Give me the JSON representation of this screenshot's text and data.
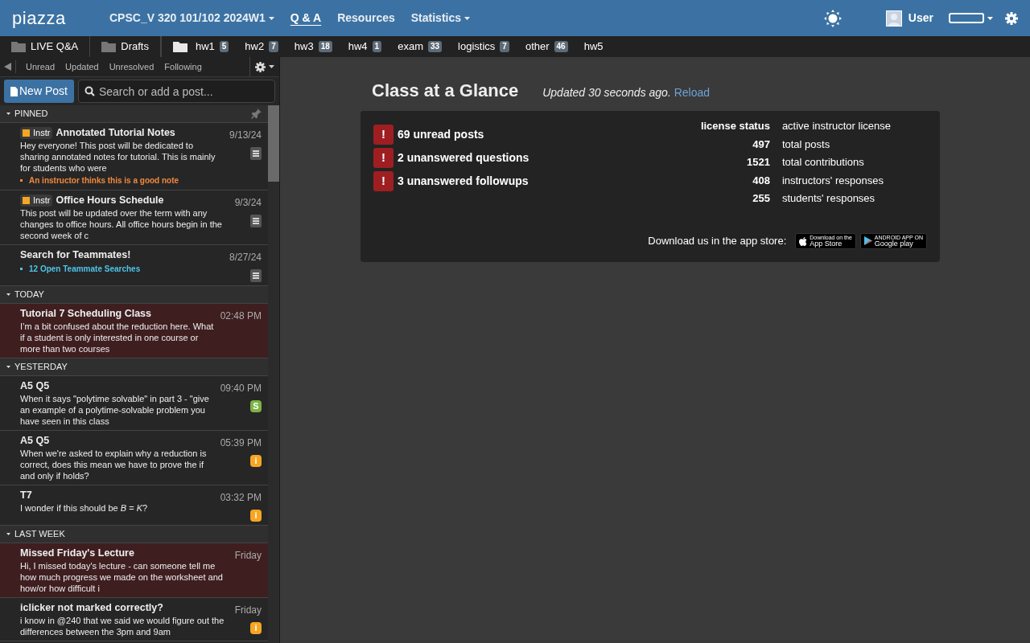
{
  "logo": "piazza",
  "nav": [
    {
      "label": "CPSC_V 320 101/102 2024W1",
      "dropdown": true,
      "selected": false
    },
    {
      "label": "Q & A",
      "dropdown": false,
      "selected": true
    },
    {
      "label": "Resources",
      "dropdown": false,
      "selected": false
    },
    {
      "label": "Statistics",
      "dropdown": true,
      "selected": false
    }
  ],
  "user": {
    "name": "User"
  },
  "folders": [
    {
      "label": "LIVE Q&A",
      "kind": "special"
    },
    {
      "label": "Drafts",
      "kind": "special"
    },
    {
      "label": "hw1",
      "kind": "folder",
      "count": "5"
    },
    {
      "label": "hw2",
      "kind": "folder",
      "count": "7"
    },
    {
      "label": "hw3",
      "kind": "folder",
      "count": "18"
    },
    {
      "label": "hw4",
      "kind": "folder",
      "count": "1"
    },
    {
      "label": "exam",
      "kind": "folder",
      "count": "33"
    },
    {
      "label": "logistics",
      "kind": "folder",
      "count": "7"
    },
    {
      "label": "other",
      "kind": "folder",
      "count": "46"
    },
    {
      "label": "hw5",
      "kind": "folder"
    }
  ],
  "filters": [
    "Unread",
    "Updated",
    "Unresolved",
    "Following"
  ],
  "new_post": "New Post",
  "search": {
    "placeholder": "Search or add a post..."
  },
  "groups": [
    {
      "label": "PINNED",
      "pinned": true,
      "posts": [
        {
          "tag": "Instr",
          "title": "Annotated Tutorial Notes",
          "snippet": "Hey everyone! This post will be dedicated to sharing annotated notes for tutorial. This is mainly for students who were",
          "date": "9/13/24",
          "kind": "note",
          "note": {
            "text": "An instructor thinks this is a good note",
            "color": "#f0883e"
          },
          "highlighted": false
        },
        {
          "tag": "Instr",
          "title": "Office Hours Schedule",
          "snippet": "This post will be updated over the term with any changes to office hours. All office hours begin in the second week of c",
          "date": "9/3/24",
          "kind": "note",
          "highlighted": false
        },
        {
          "title": "Search for Teammates!",
          "date": "8/27/24",
          "kind": "note",
          "note": {
            "text": "12 Open Teammate Searches",
            "color": "#4fc3e8"
          },
          "highlighted": false
        }
      ]
    },
    {
      "label": "TODAY",
      "pinned": false,
      "posts": [
        {
          "title": "Tutorial 7 Scheduling Class",
          "snippet": "I’m a bit confused about the reduction here. What if a student is only interested in one course or more than two courses",
          "date": "02:48 PM",
          "kind": "plain",
          "highlighted": true
        }
      ]
    },
    {
      "label": "YESTERDAY",
      "pinned": false,
      "posts": [
        {
          "title": "A5 Q5",
          "snippet": "When it says \"polytime solvable\" in part 3 - \"give an example of a polytime-solvable problem you have seen in this class",
          "date": "09:40 PM",
          "kind": "student",
          "badge_text": "S",
          "highlighted": false
        },
        {
          "title": "A5 Q5",
          "snippet": "When we're asked to explain why a reduction is correct, does this mean we have to prove the if and only if holds?",
          "date": "05:39 PM",
          "kind": "instructor",
          "badge_text": "i",
          "highlighted": false
        },
        {
          "title": "T7",
          "snippet": "I wonder if this should be *B* = *K*?",
          "date": "03:32 PM",
          "kind": "instructor",
          "badge_text": "i",
          "highlighted": false
        }
      ]
    },
    {
      "label": "LAST WEEK",
      "pinned": false,
      "posts": [
        {
          "title": "Missed Friday's Lecture",
          "snippet": "Hi, I missed today's lecture - can someone tell me how much progress we made on the worksheet and how/or how difficult i",
          "date": "Friday",
          "kind": "plain",
          "highlighted": true
        },
        {
          "title": "iclicker not marked correctly?",
          "snippet": "i know in @240 that we said we would figure out the differences between the 3pm and 9am",
          "date": "Friday",
          "kind": "instructor",
          "badge_text": "i",
          "highlighted": false
        }
      ]
    }
  ],
  "glance": {
    "title": "Class at a Glance",
    "updated": "Updated 30 seconds ago.",
    "reload": "Reload",
    "alerts": [
      {
        "mark": "!",
        "text": "69 unread posts"
      },
      {
        "mark": "!",
        "text": "2 unanswered questions"
      },
      {
        "mark": "!",
        "text": "3 unanswered followups"
      }
    ],
    "stats": [
      {
        "value": "license status",
        "label": "active instructor license"
      },
      {
        "value": "497",
        "label": "total posts"
      },
      {
        "value": "1521",
        "label": "total contributions"
      },
      {
        "value": "408",
        "label": "instructors' responses"
      },
      {
        "value": "255",
        "label": "students' responses"
      }
    ],
    "download": "Download us in the app store:",
    "stores": [
      {
        "kind": "apple",
        "top": "Download on the",
        "name": "App Store"
      },
      {
        "kind": "google",
        "top": "ANDROID APP ON",
        "name": "Google play"
      }
    ]
  }
}
